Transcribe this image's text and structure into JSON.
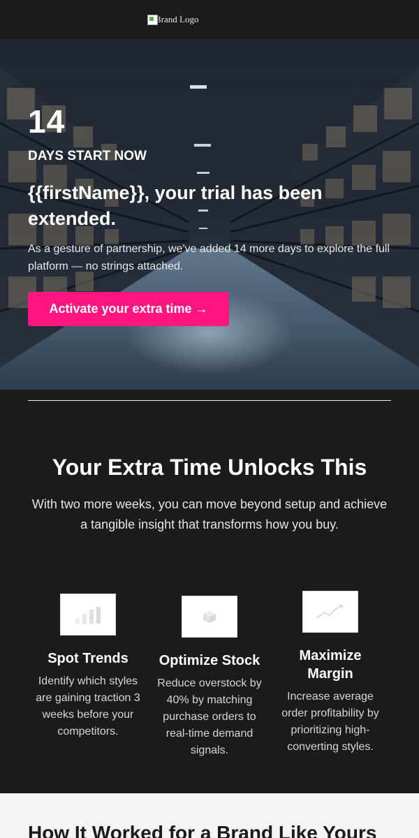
{
  "header": {
    "logo_alt": "Brand Logo"
  },
  "hero": {
    "number": "14",
    "kicker": "DAYS START NOW",
    "headline": "{{firstName}}, your trial has been extended.",
    "body": "As a gesture of partnership, we've added 14 more days to explore the full platform — no strings attached.",
    "cta_label": "Activate your extra time →",
    "accent_color": "#ff1683"
  },
  "features": {
    "title": "Your Extra Time Unlocks This",
    "subtitle": "With two more weeks, you can move beyond setup and achieve a tangible insight that transforms how you buy.",
    "items": [
      {
        "icon": "bar-chart-icon",
        "title": "Spot Trends",
        "description": "Identify which styles are gaining traction 3 weeks before your competitors."
      },
      {
        "icon": "box-icon",
        "title": "Optimize Stock",
        "description": "Reduce overstock by 40% by matching purchase orders to real-time demand signals."
      },
      {
        "icon": "trend-line-icon",
        "title": "Maximize Margin",
        "description": "Increase average order profitability by prioritizing high-converting styles."
      }
    ]
  },
  "case_study": {
    "title": "How It Worked for a Brand Like Yours"
  }
}
